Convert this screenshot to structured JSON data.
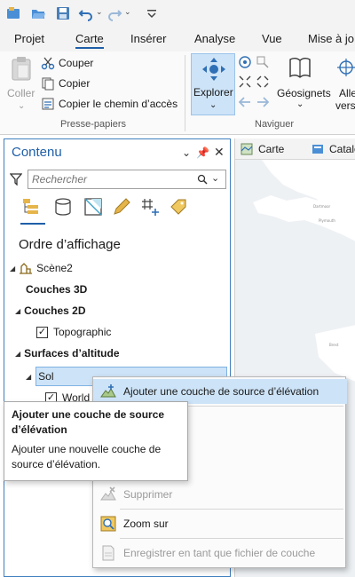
{
  "quick_access": {
    "icons": [
      "new-project-icon",
      "open-icon",
      "save-icon",
      "undo-icon",
      "redo-icon",
      "customize-icon"
    ]
  },
  "ribbon_tabs": [
    "Projet",
    "Carte",
    "Insérer",
    "Analyse",
    "Vue",
    "Mise à jo"
  ],
  "active_tab": "Carte",
  "clipboard": {
    "paste": "Coller",
    "cut": "Couper",
    "copy": "Copier",
    "copy_path": "Copier le chemin d’accès",
    "group_label": "Presse-papiers"
  },
  "navigate": {
    "explore": "Explorer",
    "bookmarks": "Géosignets",
    "goto_line1": "Alle",
    "goto_line2": "vers",
    "group_label": "Naviguer"
  },
  "map_tabs": [
    "Carte",
    "Catalo"
  ],
  "contents": {
    "title": "Contenu",
    "search_placeholder": "Rechercher",
    "section": "Ordre d’affichage",
    "tree": {
      "scene": "Scène2",
      "layers_3d": "Couches 3D",
      "layers_2d": "Couches 2D",
      "topographic": "Topographic",
      "elevation_surfaces": "Surfaces d’altitude",
      "ground": "Sol",
      "world": "World"
    }
  },
  "context_menu": {
    "items": [
      {
        "label": "Ajouter une couche de source d’élévation",
        "icon": "add-elevation-icon",
        "state": "highlighted"
      },
      {
        "label": "Supprimer",
        "icon": "delete-icon",
        "state": "disabled"
      },
      {
        "label": "Zoom sur",
        "icon": "zoom-to-icon",
        "state": "enabled"
      },
      {
        "label": "Enregistrer en tant que fichier de couche",
        "icon": "save-layer-file-icon",
        "state": "disabled"
      }
    ]
  },
  "tooltip": {
    "title": "Ajouter une couche de source d’élévation",
    "body": "Ajouter une nouvelle couche de source d’élévation."
  },
  "colors": {
    "accent": "#1f5fa8",
    "selection": "#cde3f7",
    "map_water": "#eef1f4",
    "map_land": "#ffffff"
  }
}
